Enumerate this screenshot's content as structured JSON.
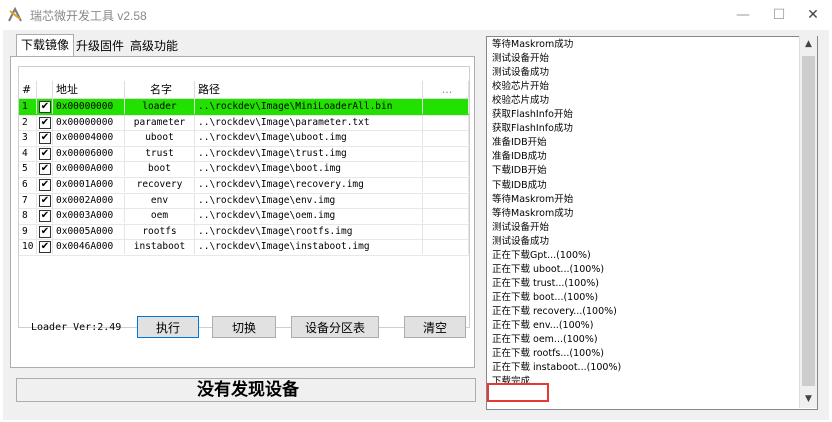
{
  "window": {
    "title": "瑞芯微开发工具 v2.58"
  },
  "titlebar": {
    "minimize": "—",
    "maximize": "☐",
    "close": "✕"
  },
  "tabs": [
    "下载镜像",
    "升级固件",
    "高级功能"
  ],
  "grid": {
    "headers": [
      "#",
      "",
      "地址",
      "名字",
      "路径",
      "..."
    ],
    "rows": [
      {
        "n": "1",
        "checked": "✔",
        "addr": "0x00000000",
        "name": "loader",
        "path": "..\\rockdev\\Image\\MiniLoaderAll.bin"
      },
      {
        "n": "2",
        "checked": "✔",
        "addr": "0x00000000",
        "name": "parameter",
        "path": "..\\rockdev\\Image\\parameter.txt"
      },
      {
        "n": "3",
        "checked": "✔",
        "addr": "0x00004000",
        "name": "uboot",
        "path": "..\\rockdev\\Image\\uboot.img"
      },
      {
        "n": "4",
        "checked": "✔",
        "addr": "0x00006000",
        "name": "trust",
        "path": "..\\rockdev\\Image\\trust.img"
      },
      {
        "n": "5",
        "checked": "✔",
        "addr": "0x0000A000",
        "name": "boot",
        "path": "..\\rockdev\\Image\\boot.img"
      },
      {
        "n": "6",
        "checked": "✔",
        "addr": "0x0001A000",
        "name": "recovery",
        "path": "..\\rockdev\\Image\\recovery.img"
      },
      {
        "n": "7",
        "checked": "✔",
        "addr": "0x0002A000",
        "name": "env",
        "path": "..\\rockdev\\Image\\env.img"
      },
      {
        "n": "8",
        "checked": "✔",
        "addr": "0x0003A000",
        "name": "oem",
        "path": "..\\rockdev\\Image\\oem.img"
      },
      {
        "n": "9",
        "checked": "✔",
        "addr": "0x0005A000",
        "name": "rootfs",
        "path": "..\\rockdev\\Image\\rootfs.img"
      },
      {
        "n": "10",
        "checked": "✔",
        "addr": "0x0046A000",
        "name": "instaboot",
        "path": "..\\rockdev\\Image\\instaboot.img"
      }
    ]
  },
  "loader_ver": "Loader Ver:2.49",
  "buttons": {
    "run": "执行",
    "switch": "切换",
    "partition": "设备分区表",
    "clear": "清空"
  },
  "status": "没有发现设备",
  "log": [
    "等待Maskrom成功",
    "测试设备开始",
    "测试设备成功",
    "校验芯片开始",
    "校验芯片成功",
    "获取FlashInfo开始",
    "获取FlashInfo成功",
    "准备IDB开始",
    "准备IDB成功",
    "下载IDB开始",
    "下载IDB成功",
    "等待Maskrom开始",
    "等待Maskrom成功",
    "测试设备开始",
    "测试设备成功",
    "正在下载Gpt...(100%)",
    "正在下载 uboot...(100%)",
    "正在下载 trust...(100%)",
    "正在下载 boot...(100%)",
    "正在下载 recovery...(100%)",
    "正在下载 env...(100%)",
    "正在下载 oem...(100%)",
    "正在下载 rootfs...(100%)",
    "正在下载 instaboot...(100%)",
    "下载完成"
  ],
  "colors": {
    "selected_row": "#22e000",
    "highlight_box": "#e53935"
  }
}
